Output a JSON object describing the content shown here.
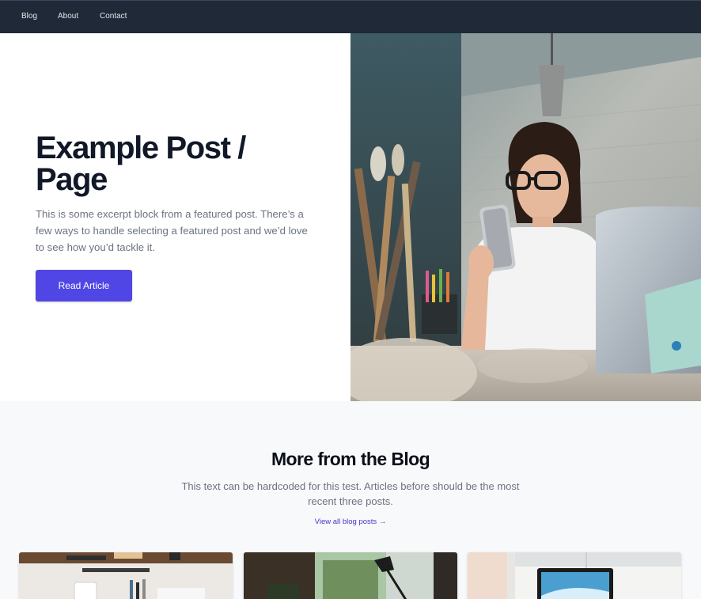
{
  "nav": {
    "items": [
      {
        "label": "Blog"
      },
      {
        "label": "About"
      },
      {
        "label": "Contact"
      }
    ]
  },
  "hero": {
    "title": "Example Post / Page",
    "excerpt": "This is some excerpt block from a featured post. There’s a few ways to handle selecting a featured post and we’d love to see how you’d tackle it.",
    "button_label": "Read Article"
  },
  "more": {
    "title": "More from the Blog",
    "subtitle": "This text can be hardcoded for this test. Articles before should be the most recent three posts.",
    "link_label": "View all blog posts →"
  },
  "colors": {
    "nav_bg": "#1f2937",
    "accent": "#4f46e5",
    "link": "#4338ca",
    "section_bg": "#f8f9fb"
  }
}
